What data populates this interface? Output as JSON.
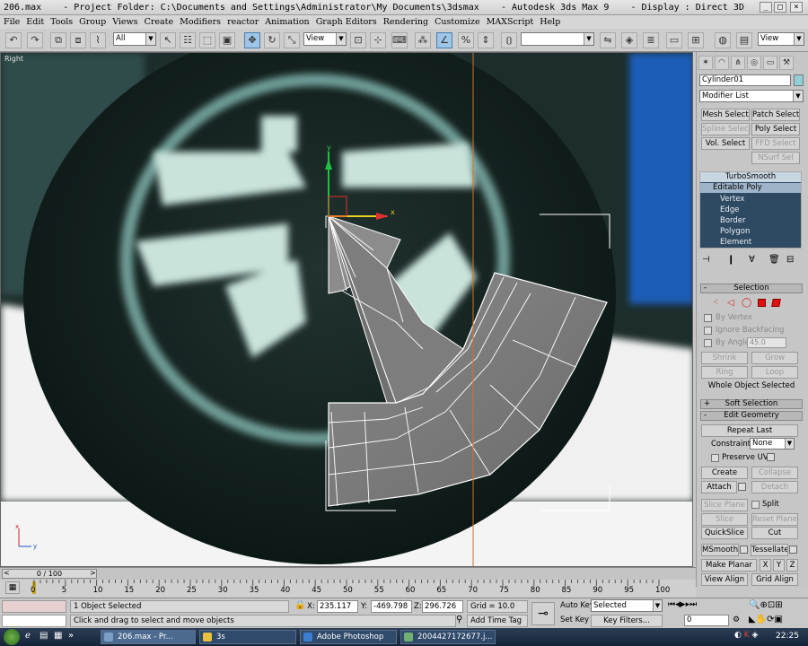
{
  "title": {
    "file": "206.max",
    "project": "- Project Folder: C:\\Documents and Settings\\Administrator\\My Documents\\3dsmax",
    "app": "- Autodesk 3ds Max 9",
    "display": "- Display : Direct 3D"
  },
  "menu": [
    "File",
    "Edit",
    "Tools",
    "Group",
    "Views",
    "Create",
    "Modifiers",
    "reactor",
    "Animation",
    "Graph Editors",
    "Rendering",
    "Customize",
    "MAXScript",
    "Help"
  ],
  "toolbar": {
    "selection_filter": "All",
    "ref_coord": "View",
    "named_sel": "",
    "view2": "View"
  },
  "viewport": {
    "label": "Right",
    "axis_x": "x",
    "axis_y": "y",
    "gizmo_x": "x",
    "gizmo_y": "y"
  },
  "command_panel": {
    "object_name": "Cylinder01",
    "object_color": "#8fd0d8",
    "modifier_list": "Modifier List",
    "quick_buttons": [
      "Mesh Select",
      "Patch Select",
      "Spline Select",
      "Poly Select",
      "Vol. Select",
      "FFD Select",
      "NSurf Sel"
    ],
    "stack": {
      "turbosmooth": "TurboSmooth",
      "editable_poly": "Editable Poly",
      "subs": [
        "Vertex",
        "Edge",
        "Border",
        "Polygon",
        "Element"
      ]
    },
    "selection": {
      "title": "Selection",
      "by_vertex": "By Vertex",
      "ignore_backfacing": "Ignore Backfacing",
      "by_angle": "By Angle",
      "angle_value": "45.0",
      "shrink": "Shrink",
      "grow": "Grow",
      "ring": "Ring",
      "loop": "Loop",
      "whole_object": "Whole Object Selected"
    },
    "soft_selection": "Soft Selection",
    "edit_geometry": {
      "title": "Edit Geometry",
      "repeat_last": "Repeat Last",
      "constraints_label": "Constraints:",
      "constraints_value": "None",
      "preserve_uvs": "Preserve UVs",
      "create": "Create",
      "collapse": "Collapse",
      "attach": "Attach",
      "detach": "Detach",
      "slice_plane": "Slice Plane",
      "split": "Split",
      "slice": "Slice",
      "reset_plane": "Reset Plane",
      "quickslice": "QuickSlice",
      "cut": "Cut",
      "msmooth": "MSmooth",
      "tessellate": "Tessellate",
      "make_planar": "Make Planar",
      "x": "X",
      "y": "Y",
      "z": "Z",
      "view_align": "View Align",
      "grid_align": "Grid Align"
    }
  },
  "timeline": {
    "frame": "0 / 100",
    "ticks": [
      "0",
      "5",
      "10",
      "15",
      "20",
      "25",
      "30",
      "35",
      "40",
      "45",
      "50",
      "55",
      "60",
      "65",
      "70",
      "75",
      "80",
      "85",
      "90",
      "95",
      "100"
    ]
  },
  "status": {
    "selected": "1 Object Selected",
    "prompt": "Click and drag to select and move objects",
    "x_label": "X:",
    "x_value": "235.117",
    "y_label": "Y:",
    "y_value": "-469.798",
    "z_label": "Z:",
    "z_value": "296.726",
    "grid": "Grid = 10.0",
    "add_time_tag": "Add Time Tag",
    "auto_key": "Auto Key",
    "set_key": "Set Key",
    "key_mode": "Selected",
    "key_filters": "Key Filters...",
    "frame_value": "0"
  },
  "taskbar": {
    "tasks": [
      "206.max - Pr...",
      "3s",
      "Adobe Photoshop",
      "2004427172677.j..."
    ],
    "clock": "22:25"
  }
}
